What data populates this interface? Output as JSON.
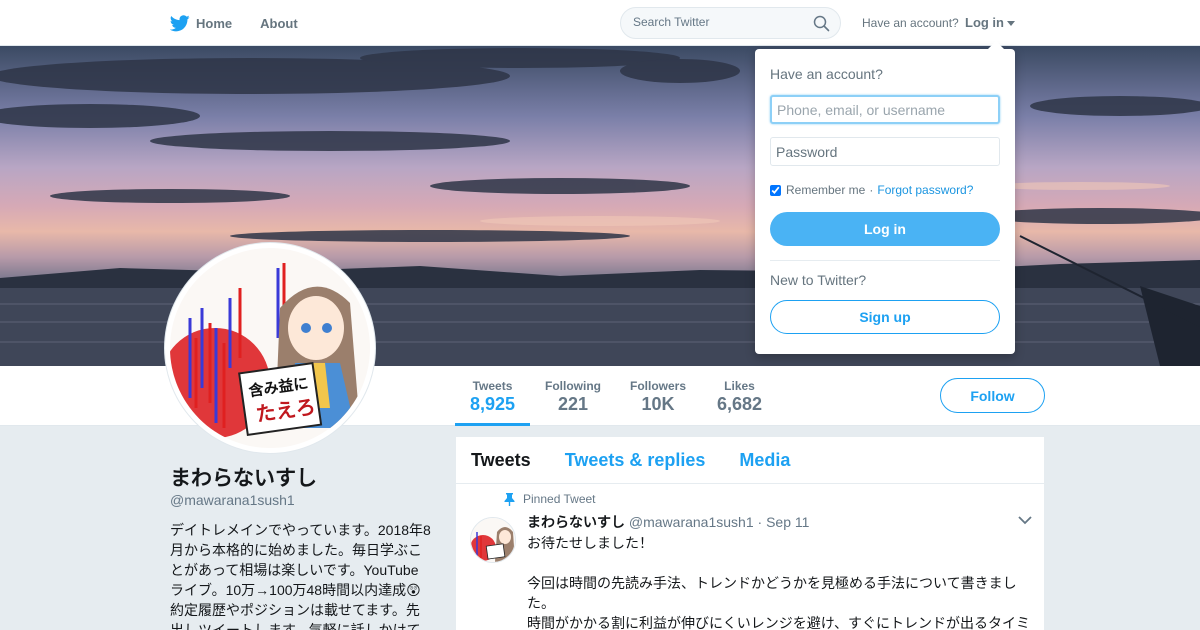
{
  "topbar": {
    "home_label": "Home",
    "about_label": "About",
    "search_placeholder": "Search Twitter",
    "have_account": "Have an account?",
    "login_label": "Log in"
  },
  "login_dropdown": {
    "title": "Have an account?",
    "username_placeholder": "Phone, email, or username",
    "password_placeholder": "Password",
    "remember_label": "Remember me",
    "separator": "·",
    "forgot_label": "Forgot password?",
    "login_button": "Log in",
    "new_label": "New to Twitter?",
    "signup_button": "Sign up"
  },
  "profile_nav": {
    "stats": [
      {
        "label": "Tweets",
        "value": "8,925",
        "active": true
      },
      {
        "label": "Following",
        "value": "221"
      },
      {
        "label": "Followers",
        "value": "10K"
      },
      {
        "label": "Likes",
        "value": "6,682"
      }
    ],
    "follow_button": "Follow"
  },
  "profile": {
    "name": "まわらないすし",
    "handle": "@mawarana1sush1",
    "bio": "デイトレメインでやっています。2018年8月から本格的に始めました。毎日学ぶことがあって相場は楽しいです。YouTubeライブ。10万→100万48時間以内達成😲約定履歴やポジションは載せてます。先出しツイートします。気軽に話しかけて"
  },
  "avatar_text": {
    "line1": "含み益に",
    "line2": "たえろ"
  },
  "timeline": {
    "tabs": [
      "Tweets",
      "Tweets & replies",
      "Media"
    ],
    "pinned_label": "Pinned Tweet",
    "tweet": {
      "name": "まわらないすし",
      "handle": "@mawarana1sush1",
      "dot": "·",
      "date": "Sep 11",
      "lines": [
        "お待たせしました！",
        "",
        "今回は時間の先読み手法、トレンドかどうかを見極める手法について書きました。",
        "時間がかかる割に利益が伸びにくいレンジを避け、すぐにトレンドが出るタイミ"
      ]
    }
  },
  "colors": {
    "accent": "#1da1f2",
    "page_bg": "#e6ecf0"
  }
}
